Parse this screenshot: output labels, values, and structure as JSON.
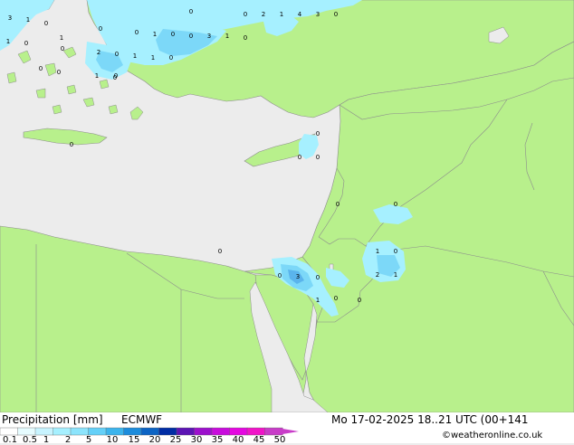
{
  "map": {
    "colors": {
      "land": "#b8f08c",
      "sea": "#ececec",
      "border": "#8c8c8c",
      "precip_light": "#a6f0ff",
      "precip_mid": "#7cd8f8",
      "precip_heavy": "#5ab4ec"
    },
    "point_values": [
      {
        "id": "p1",
        "v": "3"
      },
      {
        "id": "p2",
        "v": "1"
      },
      {
        "id": "p3",
        "v": "0"
      },
      {
        "id": "p4",
        "v": "1"
      },
      {
        "id": "p5",
        "v": "0"
      },
      {
        "id": "p6",
        "v": "0"
      },
      {
        "id": "p7",
        "v": "0"
      },
      {
        "id": "p8",
        "v": "0"
      },
      {
        "id": "p9",
        "v": "1"
      },
      {
        "id": "p10",
        "v": "0"
      },
      {
        "id": "p11",
        "v": "2"
      },
      {
        "id": "p12",
        "v": "0"
      },
      {
        "id": "p13",
        "v": "1"
      },
      {
        "id": "p14",
        "v": "1"
      },
      {
        "id": "p15",
        "v": "0"
      },
      {
        "id": "p16",
        "v": "0"
      },
      {
        "id": "p17",
        "v": "1"
      },
      {
        "id": "p18",
        "v": "0"
      },
      {
        "id": "p19",
        "v": "0"
      },
      {
        "id": "p20",
        "v": "1"
      },
      {
        "id": "p21",
        "v": "0"
      },
      {
        "id": "p22",
        "v": "0"
      },
      {
        "id": "p23",
        "v": "3"
      },
      {
        "id": "p24",
        "v": "1"
      },
      {
        "id": "p25",
        "v": "0"
      },
      {
        "id": "p26",
        "v": "0"
      },
      {
        "id": "p27",
        "v": "0"
      },
      {
        "id": "p28",
        "v": "2"
      },
      {
        "id": "p29",
        "v": "4"
      },
      {
        "id": "p30",
        "v": "3"
      },
      {
        "id": "p31",
        "v": "1"
      },
      {
        "id": "p32",
        "v": "0"
      },
      {
        "id": "p33",
        "v": "0"
      },
      {
        "id": "p34",
        "v": "0"
      },
      {
        "id": "p35",
        "v": "0"
      },
      {
        "id": "p36",
        "v": "0"
      },
      {
        "id": "p37",
        "v": "0"
      },
      {
        "id": "p38",
        "v": "0"
      },
      {
        "id": "p39",
        "v": "0"
      },
      {
        "id": "p40",
        "v": "1"
      },
      {
        "id": "p41",
        "v": "0"
      },
      {
        "id": "p42",
        "v": "2"
      },
      {
        "id": "p43",
        "v": "1"
      },
      {
        "id": "p44",
        "v": "0"
      },
      {
        "id": "p45",
        "v": "3"
      },
      {
        "id": "p46",
        "v": "0"
      },
      {
        "id": "p47",
        "v": "1"
      },
      {
        "id": "p48",
        "v": "0"
      },
      {
        "id": "p49",
        "v": "0"
      }
    ]
  },
  "footer": {
    "title": "Precipitation [mm]",
    "model": "ECMWF",
    "datetime": "Mo 17-02-2025 18..21 UTC (00+141",
    "credit": "©weatheronline.co.uk",
    "legend": {
      "colors": [
        "#ffffff",
        "#e6fcff",
        "#c8f4ff",
        "#a6f0ff",
        "#8ce4fc",
        "#64d0f8",
        "#3cb4ec",
        "#1c8cdc",
        "#0c64c4",
        "#002ca4",
        "#5c14b4",
        "#9c10cc",
        "#c80cdc",
        "#e408e0",
        "#f014c8",
        "#c83cc8"
      ],
      "ticks": [
        "0.1",
        "0.5",
        "1",
        "2",
        "5",
        "10",
        "15",
        "20",
        "25",
        "30",
        "35",
        "40",
        "45",
        "50"
      ]
    }
  }
}
